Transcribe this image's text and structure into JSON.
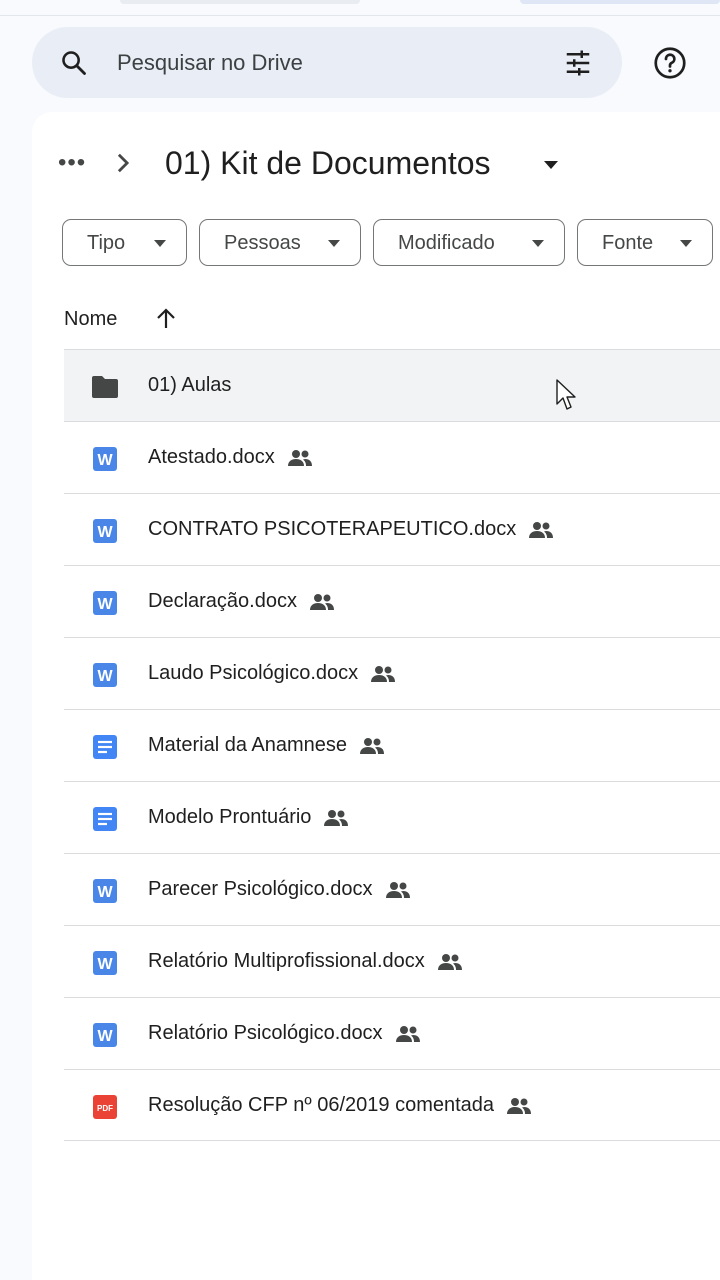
{
  "search": {
    "placeholder": "Pesquisar no Drive"
  },
  "breadcrumb": {
    "more": "•••",
    "title": "01) Kit de Documentos"
  },
  "filters": [
    {
      "label": "Tipo"
    },
    {
      "label": "Pessoas"
    },
    {
      "label": "Modificado"
    },
    {
      "label": "Fonte"
    }
  ],
  "list": {
    "column_name": "Nome",
    "items": [
      {
        "name": "01) Aulas",
        "type": "folder",
        "shared": false
      },
      {
        "name": "Atestado.docx",
        "type": "word",
        "shared": true
      },
      {
        "name": "CONTRATO PSICOTERAPEUTICO.docx",
        "type": "word",
        "shared": true
      },
      {
        "name": "Declaração.docx",
        "type": "word",
        "shared": true
      },
      {
        "name": "Laudo Psicológico.docx",
        "type": "word",
        "shared": true
      },
      {
        "name": "Material da Anamnese",
        "type": "doc",
        "shared": true
      },
      {
        "name": "Modelo Prontuário",
        "type": "doc",
        "shared": true
      },
      {
        "name": "Parecer Psicológico.docx",
        "type": "word",
        "shared": true
      },
      {
        "name": "Relatório Multiprofissional.docx",
        "type": "word",
        "shared": true
      },
      {
        "name": "Relatório Psicológico.docx",
        "type": "word",
        "shared": true
      },
      {
        "name": "Resolução CFP nº 06/2019 comentada",
        "type": "pdf",
        "shared": true
      }
    ]
  },
  "icons": {
    "search": "search-icon",
    "tune": "tune-icon",
    "help": "help-icon",
    "folder": "folder-icon",
    "word": "word-file-icon",
    "doc": "google-docs-icon",
    "pdf": "pdf-file-icon",
    "shared": "shared-people-icon"
  },
  "colors": {
    "word_blue": "#4a86e8",
    "docs_blue": "#4285f4",
    "pdf_red": "#ea4335",
    "search_bg": "#e9eef6"
  }
}
